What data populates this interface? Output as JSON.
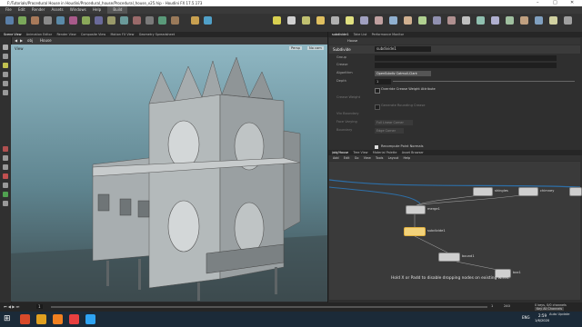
{
  "window": {
    "title": "F:/Tutorials/Procedural House in Houdini/Procedural_house/Procedural_house_v25.hip - Houdini FX 17.5.173",
    "controls": [
      "–",
      "□",
      "✕"
    ]
  },
  "menubar": {
    "items": [
      "File",
      "Edit",
      "Render",
      "Assets",
      "Windows",
      "Help",
      "Build"
    ]
  },
  "pane_tabs": {
    "left": [
      "Scene View",
      "Animation Editor",
      "Render View",
      "Composite View",
      "Motion FX View",
      "Geometry Spreadsheet"
    ],
    "right": [
      "subdivide1",
      "Take List",
      "Performance Monitor"
    ]
  },
  "viewport": {
    "path": "obj",
    "path_node": "House",
    "label": "View",
    "persp": "Persp",
    "cam": "No cam"
  },
  "params": {
    "node_type": "Subdivide",
    "node_name": "subdivide1",
    "rows": [
      {
        "label": "Group",
        "value": ""
      },
      {
        "label": "Crease",
        "value": ""
      },
      {
        "label": "Algorithm",
        "value": "OpenSubdiv Catmull-Clark"
      },
      {
        "label": "Depth",
        "value": "1"
      },
      {
        "label": "",
        "value": "Override Crease Weight Attribute"
      },
      {
        "label": "Crease Weight",
        "value": ""
      },
      {
        "label": "",
        "value": "Generate Rounding Crease"
      },
      {
        "label": "Vtx Boundary",
        "value": ""
      },
      {
        "label": "Face Varying",
        "value": "Full Linear Corner"
      },
      {
        "label": "Boundary",
        "value": "Edge Corner"
      },
      {
        "label": "",
        "value": ""
      },
      {
        "label": "",
        "value": "Recompute Point Normals"
      }
    ]
  },
  "network": {
    "tabs": [
      "/obj/House",
      "Tree View",
      "Material Palette",
      "Asset Browser"
    ],
    "menu": [
      "Add",
      "Edit",
      "Go",
      "View",
      "Tools",
      "Layout",
      "Help"
    ],
    "path_node": "House",
    "nodes": [
      {
        "name": "shingles"
      },
      {
        "name": "chimney"
      },
      {
        "name": "merge1"
      },
      {
        "name": "subdivide1"
      },
      {
        "name": "bound1"
      },
      {
        "name": "box1"
      }
    ],
    "hint": "Hold X or Padd to disable dropping nodes on existing wires."
  },
  "timeline": {
    "frame": "1",
    "start": "1",
    "end": "240",
    "range_end": "240",
    "keys_label": "0 keys, 0/0 channels",
    "key_all_label": "Key All Channels"
  },
  "taskbar": {
    "time": "2:59",
    "date": "1/6/2020",
    "lang": "ENG",
    "auto_update": "Auto Update"
  },
  "colors": {
    "accent_node_selected": "#f2d27a",
    "viewport_top": "#8fb7c3",
    "taskbar": "#1b2a38"
  }
}
